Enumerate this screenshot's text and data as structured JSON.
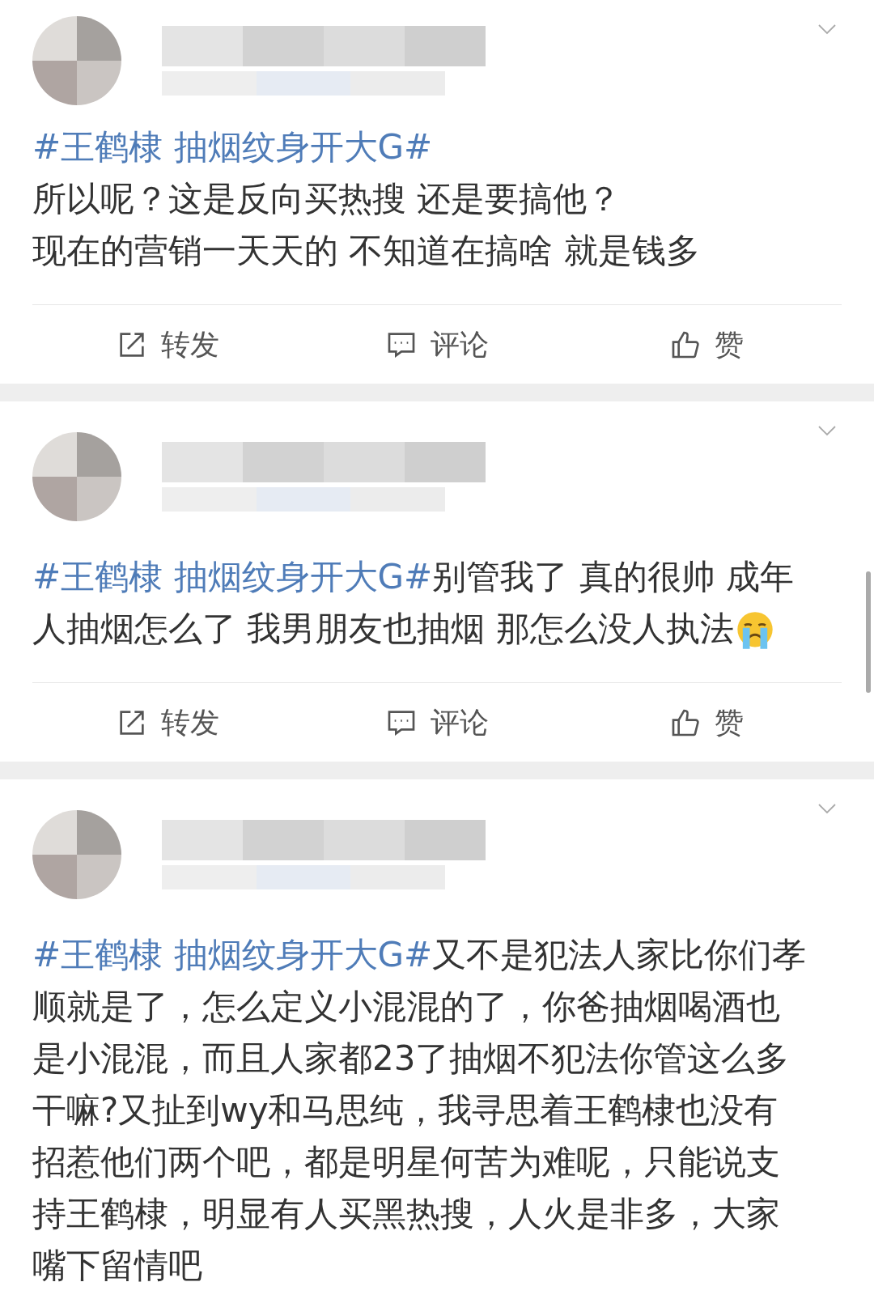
{
  "posts": [
    {
      "paragraphs": [
        [
          {
            "kind": "hashtag",
            "text": "#王鹤棣 抽烟纹身开大G#"
          }
        ],
        [
          {
            "kind": "text",
            "text": "所以呢？这是反向买热搜 还是要搞他？"
          }
        ],
        [
          {
            "kind": "text",
            "text": "现在的营销一天天的 不知道在搞啥 就是钱多"
          }
        ]
      ],
      "actions": [
        {
          "kind": "repost",
          "label": "转发"
        },
        {
          "kind": "comment",
          "label": "评论"
        },
        {
          "kind": "like",
          "label": "赞"
        }
      ]
    },
    {
      "paragraphs": [
        [
          {
            "kind": "hashtag",
            "text": "#王鹤棣 抽烟纹身开大G#"
          },
          {
            "kind": "text",
            "text": "别管我了 真的很帅 成年人抽烟怎么了 我男朋友也抽烟 那怎么没人执法"
          },
          {
            "kind": "emoji"
          }
        ]
      ],
      "actions": [
        {
          "kind": "repost",
          "label": "转发"
        },
        {
          "kind": "comment",
          "label": "评论"
        },
        {
          "kind": "like",
          "label": "赞"
        }
      ]
    },
    {
      "paragraphs": [
        [
          {
            "kind": "hashtag",
            "text": "#王鹤棣 抽烟纹身开大G#"
          },
          {
            "kind": "text",
            "text": "又不是犯法人家比你们孝顺就是了，怎么定义小混混的了，你爸抽烟喝酒也是小混混，而且人家都23了抽烟不犯法你管这么多干嘛?又扯到wy和马思纯，我寻思着王鹤棣也没有招惹他们两个吧，都是明星何苦为难呢，只能说支持王鹤棣，明显有人买黑热搜，人火是非多，大家嘴下留情吧"
          }
        ]
      ]
    }
  ]
}
